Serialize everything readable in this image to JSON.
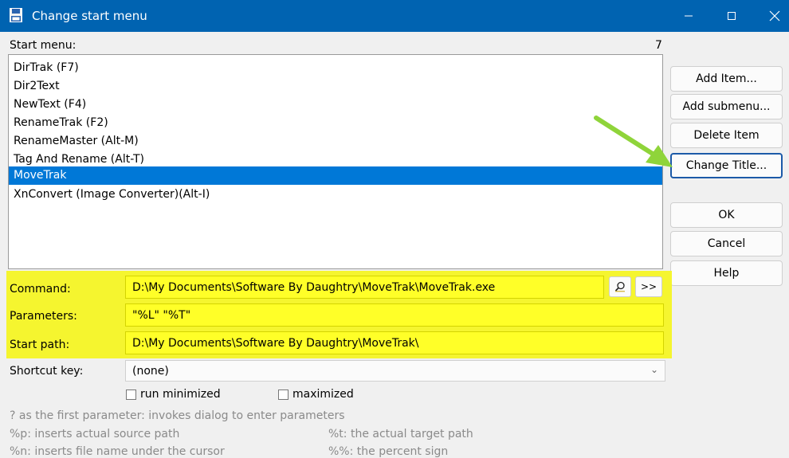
{
  "window": {
    "title": "Change start menu",
    "app_icon": "floppy-disk-icon"
  },
  "start_menu": {
    "label": "Start menu:",
    "count": "7",
    "items": [
      "DirTrak (F7)",
      "Dir2Text",
      "NewText (F4)",
      "RenameTrak (F2)",
      "RenameMaster (Alt-M)",
      "Tag And Rename (Alt-T)",
      "MoveTrak",
      "XnConvert (Image Converter)(Alt-I)"
    ],
    "selected_index": 6
  },
  "buttons": {
    "add_item": "Add Item...",
    "add_submenu": "Add submenu...",
    "delete_item": "Delete Item",
    "change_title": "Change Title...",
    "ok": "OK",
    "cancel": "Cancel",
    "help": "Help"
  },
  "form": {
    "command_label": "Command:",
    "command_value": "D:\\My Documents\\Software By Daughtry\\MoveTrak\\MoveTrak.exe",
    "parameters_label": "Parameters:",
    "parameters_value": "\"%L\" \"%T\"",
    "start_path_label": "Start path:",
    "start_path_value": "D:\\My Documents\\Software By Daughtry\\MoveTrak\\",
    "shortcut_label": "Shortcut key:",
    "shortcut_value": "(none)",
    "more_button": ">>",
    "run_minimized": "run minimized",
    "maximized": "maximized"
  },
  "hints": {
    "line1": "? as the first parameter: invokes dialog to enter parameters",
    "line2a": "%p: inserts actual source path",
    "line2b": "%t: the actual target path",
    "line3a": "%n: inserts file name under the cursor",
    "line3b": "%%: the percent sign"
  },
  "colors": {
    "titlebar": "#0063b1",
    "selection": "#0078d7",
    "highlight": "#f5f52f",
    "arrow": "#8fd43a"
  }
}
